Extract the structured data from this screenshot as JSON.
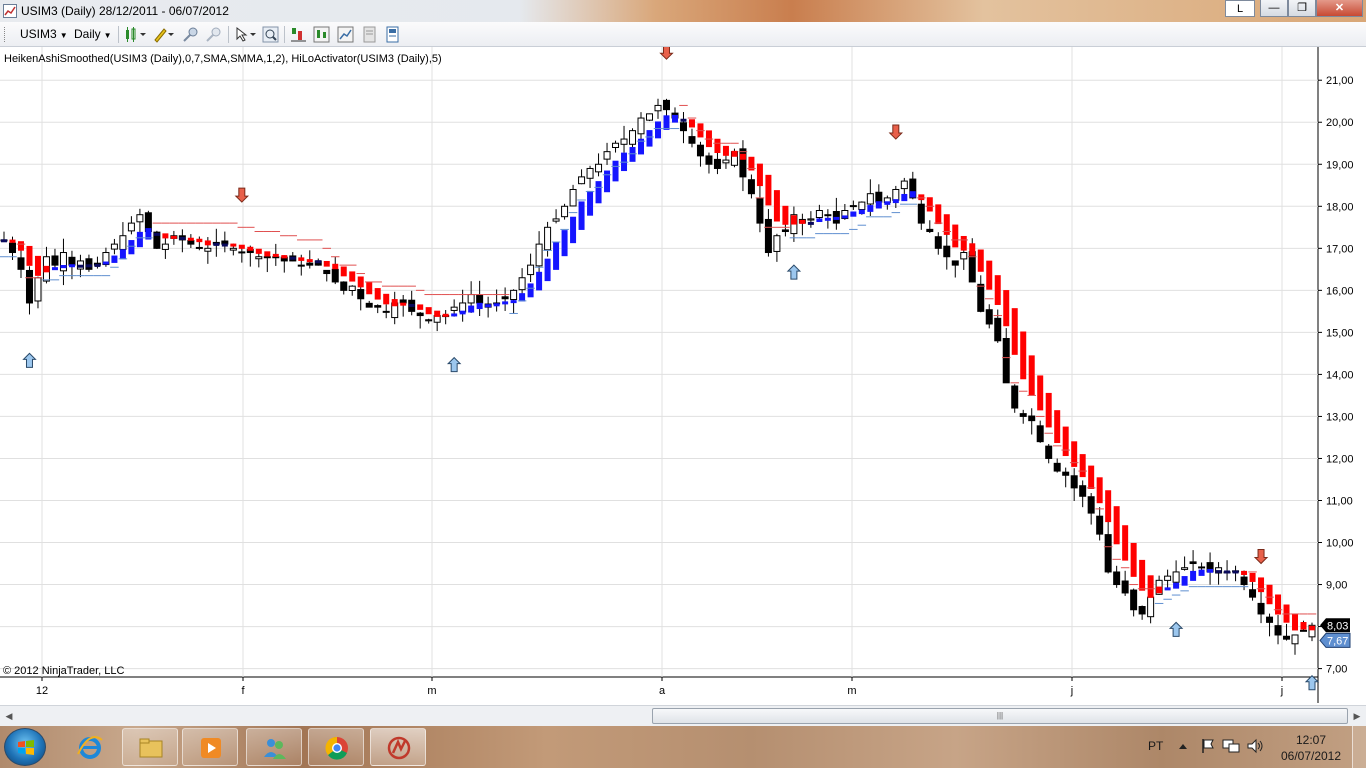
{
  "window": {
    "title": "USIM3 (Daily)  28/12/2011 - 06/07/2012",
    "l_button": "L",
    "minimize": "—",
    "maximize": "❐",
    "close": "✕"
  },
  "toolbar": {
    "instrument": "USIM3",
    "period": "Daily",
    "icons": [
      "candlestick-style-icon",
      "pencil-draw-icon",
      "zoom-in-icon",
      "zoom-out-icon",
      "cursor-pointer-icon",
      "magnifier-icon",
      "strategy-icon",
      "indicators-icon",
      "chart-properties-icon",
      "data-box-icon",
      "page-icon"
    ]
  },
  "chart": {
    "indicator_label": "HeikenAshiSmoothed(USIM3 (Daily),0,7,SMA,SMMA,1,2), HiLoActivator(USIM3 (Daily),5)",
    "copyright": "© 2012 NinjaTrader, LLC",
    "last_price": "8,03",
    "activator_value": "7,67",
    "colors": {
      "bull": "#1515ff",
      "bear": "#ff0000",
      "neutral_dark": "#0a0a5c",
      "activator_up": "#5f8fd0",
      "activator_down": "#e05050",
      "grid": "#e0e0e0"
    }
  },
  "chart_data": {
    "type": "candlestick",
    "y_axis": {
      "min": 6.8,
      "max": 21.6,
      "ticks": [
        "7,00",
        "8,00",
        "9,00",
        "10,00",
        "11,00",
        "12,00",
        "13,00",
        "14,00",
        "15,00",
        "16,00",
        "17,00",
        "18,00",
        "19,00",
        "20,00",
        "21,00"
      ]
    },
    "x_axis": {
      "tick_labels": [
        "12",
        "f",
        "m",
        "a",
        "m",
        "j",
        "j"
      ]
    },
    "closes": [
      17.2,
      16.9,
      16.5,
      15.7,
      16.3,
      16.8,
      16.6,
      16.9,
      16.6,
      16.7,
      16.5,
      16.6,
      16.9,
      17.1,
      17.3,
      17.6,
      17.8,
      17.4,
      17.0,
      17.1,
      17.3,
      17.2,
      17.1,
      17.0,
      17.0,
      17.1,
      17.1,
      17.0,
      16.9,
      16.9,
      16.8,
      16.8,
      16.8,
      16.7,
      16.7,
      16.6,
      16.6,
      16.6,
      16.4,
      16.2,
      16.0,
      16.1,
      15.8,
      15.6,
      15.6,
      15.5,
      15.7,
      15.7,
      15.5,
      15.4,
      15.3,
      15.4,
      15.4,
      15.6,
      15.7,
      15.9,
      15.7,
      15.6,
      15.7,
      15.8,
      16.0,
      16.3,
      16.6,
      17.1,
      17.5,
      17.7,
      18.0,
      18.4,
      18.7,
      18.9,
      19.0,
      19.3,
      19.5,
      19.6,
      19.8,
      20.1,
      20.2,
      20.4,
      20.3,
      20.1,
      19.8,
      19.5,
      19.2,
      19.0,
      18.9,
      19.1,
      19.3,
      18.7,
      18.3,
      17.6,
      16.9,
      17.3,
      17.4,
      17.8,
      17.6,
      17.7,
      17.9,
      17.8,
      17.6,
      17.9,
      18.0,
      18.1,
      18.3,
      18.1,
      18.2,
      18.4,
      18.6,
      18.2,
      17.6,
      17.4,
      17.0,
      16.8,
      16.6,
      16.9,
      16.2,
      15.5,
      15.2,
      14.8,
      13.8,
      13.2,
      13.0,
      12.9,
      12.4,
      12.0,
      11.7,
      11.6,
      11.3,
      11.1,
      10.7,
      10.2,
      9.3,
      9.0,
      8.8,
      8.4,
      8.3,
      8.7,
      9.1,
      9.2,
      9.3,
      9.4,
      9.5,
      9.4,
      9.3,
      9.4,
      9.3,
      9.3,
      9.0,
      8.7,
      8.3,
      8.1,
      7.8,
      7.7,
      7.8,
      7.9,
      8.03
    ]
  }
}
